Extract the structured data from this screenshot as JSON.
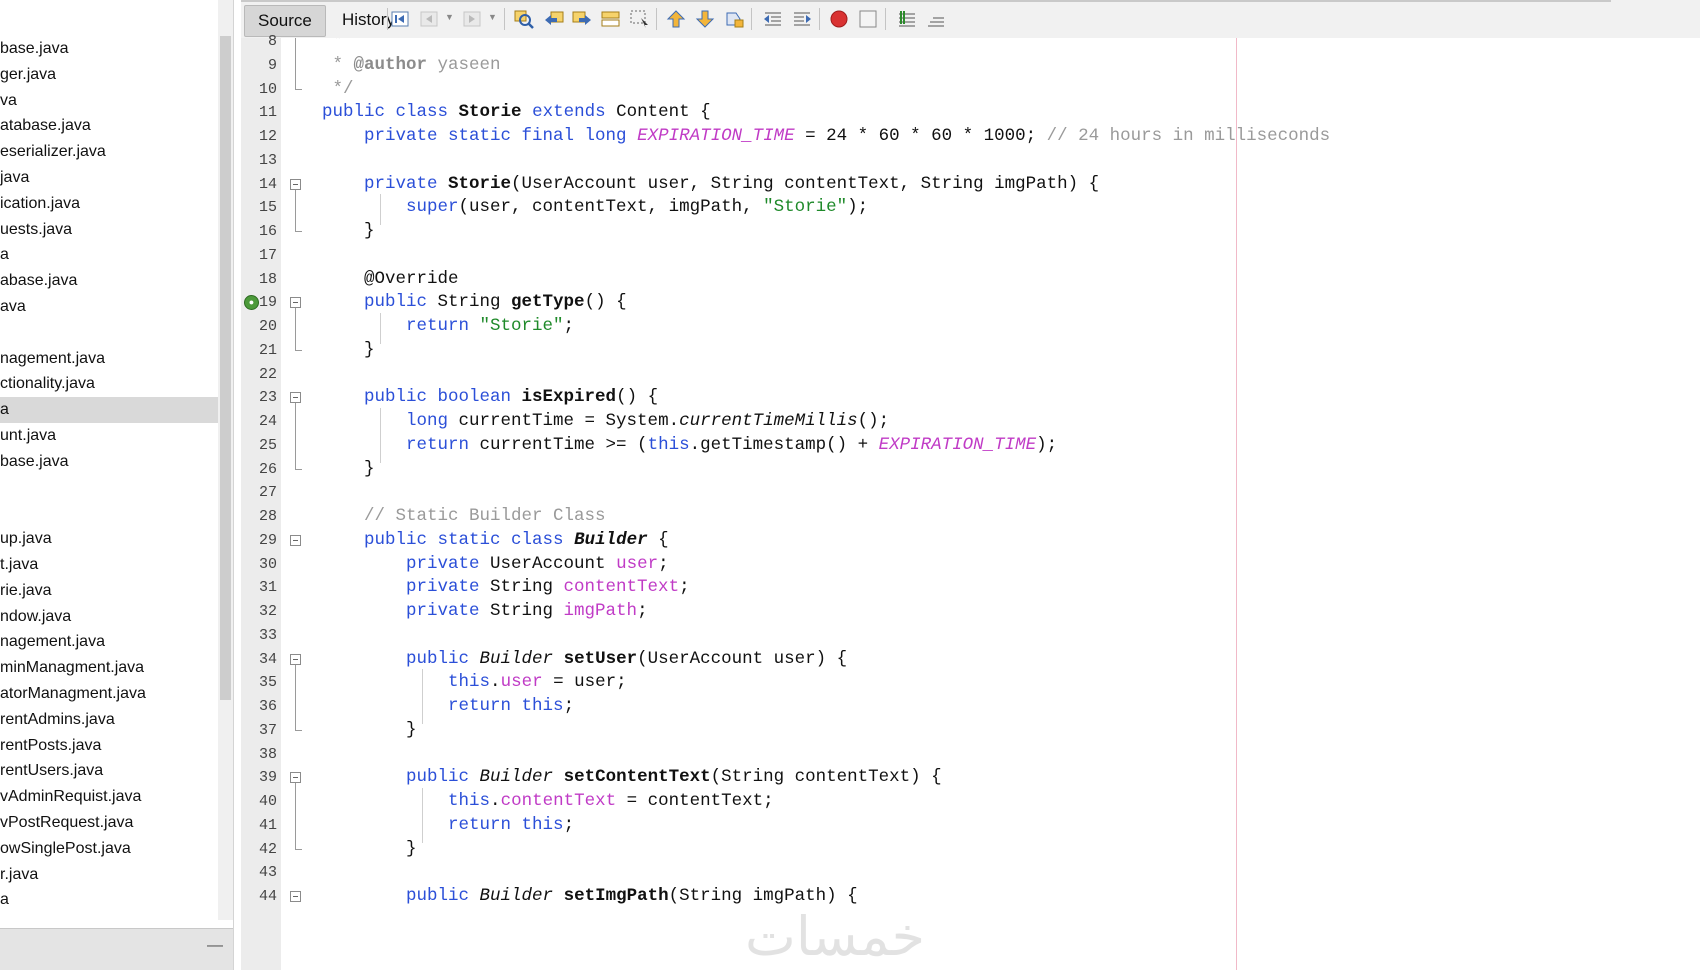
{
  "project_tree": {
    "items": [
      {
        "label": "base.java",
        "selected": false
      },
      {
        "label": "ger.java",
        "selected": false
      },
      {
        "label": "va",
        "selected": false
      },
      {
        "label": "atabase.java",
        "selected": false
      },
      {
        "label": "eserializer.java",
        "selected": false
      },
      {
        "label": "java",
        "selected": false
      },
      {
        "label": "ication.java",
        "selected": false
      },
      {
        "label": "uests.java",
        "selected": false
      },
      {
        "label": "a",
        "selected": false
      },
      {
        "label": "abase.java",
        "selected": false
      },
      {
        "label": "ava",
        "selected": false
      },
      {
        "label": "",
        "selected": false
      },
      {
        "label": "nagement.java",
        "selected": false
      },
      {
        "label": "ctionality.java",
        "selected": false
      },
      {
        "label": "a",
        "selected": true
      },
      {
        "label": "unt.java",
        "selected": false
      },
      {
        "label": "base.java",
        "selected": false
      },
      {
        "label": "",
        "selected": false
      },
      {
        "label": "",
        "selected": false
      },
      {
        "label": "up.java",
        "selected": false
      },
      {
        "label": "t.java",
        "selected": false
      },
      {
        "label": "rie.java",
        "selected": false
      },
      {
        "label": "ndow.java",
        "selected": false
      },
      {
        "label": "nagement.java",
        "selected": false
      },
      {
        "label": "minManagment.java",
        "selected": false
      },
      {
        "label": "atorManagment.java",
        "selected": false
      },
      {
        "label": "rentAdmins.java",
        "selected": false
      },
      {
        "label": "rentPosts.java",
        "selected": false
      },
      {
        "label": "rentUsers.java",
        "selected": false
      },
      {
        "label": "vAdminRequist.java",
        "selected": false
      },
      {
        "label": "vPostRequest.java",
        "selected": false
      },
      {
        "label": "owSinglePost.java",
        "selected": false
      },
      {
        "label": "r.java",
        "selected": false
      },
      {
        "label": "a",
        "selected": false
      }
    ],
    "minimize_label": "—"
  },
  "toolbar": {
    "source_tab": "Source",
    "history_tab": "History",
    "icons": [
      "last-edit-icon",
      "back-icon",
      "forward-icon",
      "find-selection-icon",
      "find-previous-icon",
      "find-next-icon",
      "toggle-highlight-icon",
      "toggle-rect-selection-icon",
      "previous-bookmark-icon",
      "next-bookmark-icon",
      "toggle-bookmark-icon",
      "shift-left-icon",
      "shift-right-icon",
      "start-macro-icon",
      "stop-macro-icon",
      "comment-icon",
      "uncomment-icon"
    ]
  },
  "editor": {
    "line_numbers": [
      "8",
      "9",
      "10",
      "11",
      "12",
      "13",
      "14",
      "15",
      "16",
      "17",
      "18",
      "19",
      "20",
      "21",
      "22",
      "23",
      "24",
      "25",
      "26",
      "27",
      "28",
      "29",
      "30",
      "31",
      "32",
      "33",
      "34",
      "35",
      "36",
      "37",
      "38",
      "39",
      "40",
      "41",
      "42",
      "43",
      "44"
    ],
    "lines": [
      [
        {
          "t": " *",
          "c": "cm"
        }
      ],
      [
        {
          "t": " * ",
          "c": "cm"
        },
        {
          "t": "@author",
          "c": "cmb"
        },
        {
          "t": " yaseen",
          "c": "cm"
        }
      ],
      [
        {
          "t": " */",
          "c": "cm"
        }
      ],
      [
        {
          "t": "public class ",
          "c": "kw"
        },
        {
          "t": "Storie",
          "c": "b"
        },
        {
          "t": " "
        },
        {
          "t": "extends",
          "c": "kw"
        },
        {
          "t": " Content {"
        }
      ],
      [
        {
          "t": "    "
        },
        {
          "t": "private static final long ",
          "c": "kw"
        },
        {
          "t": "EXPIRATION_TIME",
          "c": "fldi"
        },
        {
          "t": " = 24 * 60 * 60 * 1000; "
        },
        {
          "t": "// 24 hours in milliseconds",
          "c": "cm"
        }
      ],
      [
        {
          "t": ""
        }
      ],
      [
        {
          "t": "    "
        },
        {
          "t": "private ",
          "c": "kw"
        },
        {
          "t": "Storie",
          "c": "b"
        },
        {
          "t": "(UserAccount user, String contentText, String imgPath) {"
        }
      ],
      [
        {
          "t": "        "
        },
        {
          "t": "super",
          "c": "kw"
        },
        {
          "t": "(user, contentText, imgPath, "
        },
        {
          "t": "\"Storie\"",
          "c": "str"
        },
        {
          "t": ");"
        }
      ],
      [
        {
          "t": "    }"
        }
      ],
      [
        {
          "t": ""
        }
      ],
      [
        {
          "t": "    @Override"
        }
      ],
      [
        {
          "t": "    "
        },
        {
          "t": "public ",
          "c": "kw"
        },
        {
          "t": "String "
        },
        {
          "t": "getType",
          "c": "b"
        },
        {
          "t": "() {"
        }
      ],
      [
        {
          "t": "        "
        },
        {
          "t": "return ",
          "c": "kw"
        },
        {
          "t": "\"Storie\"",
          "c": "str"
        },
        {
          "t": ";"
        }
      ],
      [
        {
          "t": "    }"
        }
      ],
      [
        {
          "t": ""
        }
      ],
      [
        {
          "t": "    "
        },
        {
          "t": "public boolean ",
          "c": "kw"
        },
        {
          "t": "isExpired",
          "c": "b"
        },
        {
          "t": "() {"
        }
      ],
      [
        {
          "t": "        "
        },
        {
          "t": "long ",
          "c": "kw"
        },
        {
          "t": "currentTime = System."
        },
        {
          "t": "currentTimeMillis",
          "c": "it"
        },
        {
          "t": "();"
        }
      ],
      [
        {
          "t": "        "
        },
        {
          "t": "return ",
          "c": "kw"
        },
        {
          "t": "currentTime >= ("
        },
        {
          "t": "this",
          "c": "kw"
        },
        {
          "t": ".getTimestamp() + "
        },
        {
          "t": "EXPIRATION_TIME",
          "c": "fldi"
        },
        {
          "t": ");"
        }
      ],
      [
        {
          "t": "    }"
        }
      ],
      [
        {
          "t": ""
        }
      ],
      [
        {
          "t": "    "
        },
        {
          "t": "// Static Builder Class",
          "c": "cm"
        }
      ],
      [
        {
          "t": "    "
        },
        {
          "t": "public static class ",
          "c": "kw"
        },
        {
          "t": "Builder",
          "c": "bi"
        },
        {
          "t": " {"
        }
      ],
      [
        {
          "t": "        "
        },
        {
          "t": "private ",
          "c": "kw"
        },
        {
          "t": "UserAccount "
        },
        {
          "t": "user",
          "c": "fld"
        },
        {
          "t": ";"
        }
      ],
      [
        {
          "t": "        "
        },
        {
          "t": "private ",
          "c": "kw"
        },
        {
          "t": "String "
        },
        {
          "t": "contentText",
          "c": "fld"
        },
        {
          "t": ";"
        }
      ],
      [
        {
          "t": "        "
        },
        {
          "t": "private ",
          "c": "kw"
        },
        {
          "t": "String "
        },
        {
          "t": "imgPath",
          "c": "fld"
        },
        {
          "t": ";"
        }
      ],
      [
        {
          "t": ""
        }
      ],
      [
        {
          "t": "        "
        },
        {
          "t": "public ",
          "c": "kw"
        },
        {
          "t": "Builder",
          "c": "it"
        },
        {
          "t": " "
        },
        {
          "t": "setUser",
          "c": "b"
        },
        {
          "t": "(UserAccount user) {"
        }
      ],
      [
        {
          "t": "            "
        },
        {
          "t": "this",
          "c": "kw"
        },
        {
          "t": "."
        },
        {
          "t": "user",
          "c": "fld"
        },
        {
          "t": " = user;"
        }
      ],
      [
        {
          "t": "            "
        },
        {
          "t": "return this",
          "c": "kw"
        },
        {
          "t": ";"
        }
      ],
      [
        {
          "t": "        }"
        }
      ],
      [
        {
          "t": ""
        }
      ],
      [
        {
          "t": "        "
        },
        {
          "t": "public ",
          "c": "kw"
        },
        {
          "t": "Builder",
          "c": "it"
        },
        {
          "t": " "
        },
        {
          "t": "setContentText",
          "c": "b"
        },
        {
          "t": "(String contentText) {"
        }
      ],
      [
        {
          "t": "            "
        },
        {
          "t": "this",
          "c": "kw"
        },
        {
          "t": "."
        },
        {
          "t": "contentText",
          "c": "fld"
        },
        {
          "t": " = contentText;"
        }
      ],
      [
        {
          "t": "            "
        },
        {
          "t": "return this",
          "c": "kw"
        },
        {
          "t": ";"
        }
      ],
      [
        {
          "t": "        }"
        }
      ],
      [
        {
          "t": ""
        }
      ],
      [
        {
          "t": "        "
        },
        {
          "t": "public ",
          "c": "kw"
        },
        {
          "t": "Builder",
          "c": "it"
        },
        {
          "t": " "
        },
        {
          "t": "setImgPath",
          "c": "b"
        },
        {
          "t": "(String imgPath) {"
        }
      ]
    ],
    "override_marker_line": "19",
    "override_marker_glyph": "●"
  },
  "watermark": "خمسات"
}
